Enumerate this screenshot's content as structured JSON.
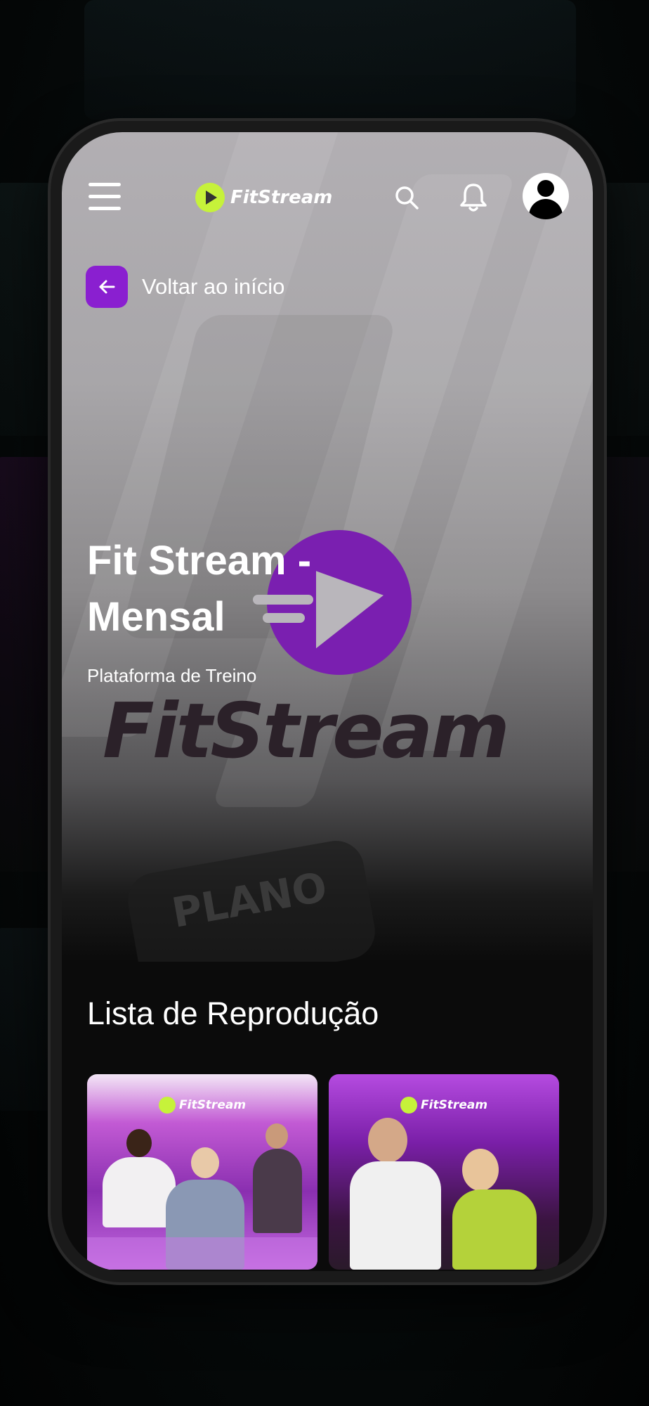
{
  "header": {
    "logo_text": "FitStream"
  },
  "back": {
    "label": "Voltar ao início"
  },
  "plan": {
    "title_line1": "Fit Stream -",
    "title_line2": "Mensal",
    "subtitle": "Plataforma de Treino",
    "brand_word": "FitStream",
    "badge_text": "PLANO"
  },
  "playlist": {
    "title": "Lista de Reprodução",
    "cards": [
      {
        "logo_text": "FitStream"
      },
      {
        "logo_text": "FitStream"
      }
    ]
  },
  "colors": {
    "accent_purple": "#8a1fd0",
    "logo_lime": "#c6f23a"
  },
  "icons": [
    "menu-icon",
    "search-icon",
    "bell-icon",
    "user-icon",
    "arrow-left-icon"
  ]
}
